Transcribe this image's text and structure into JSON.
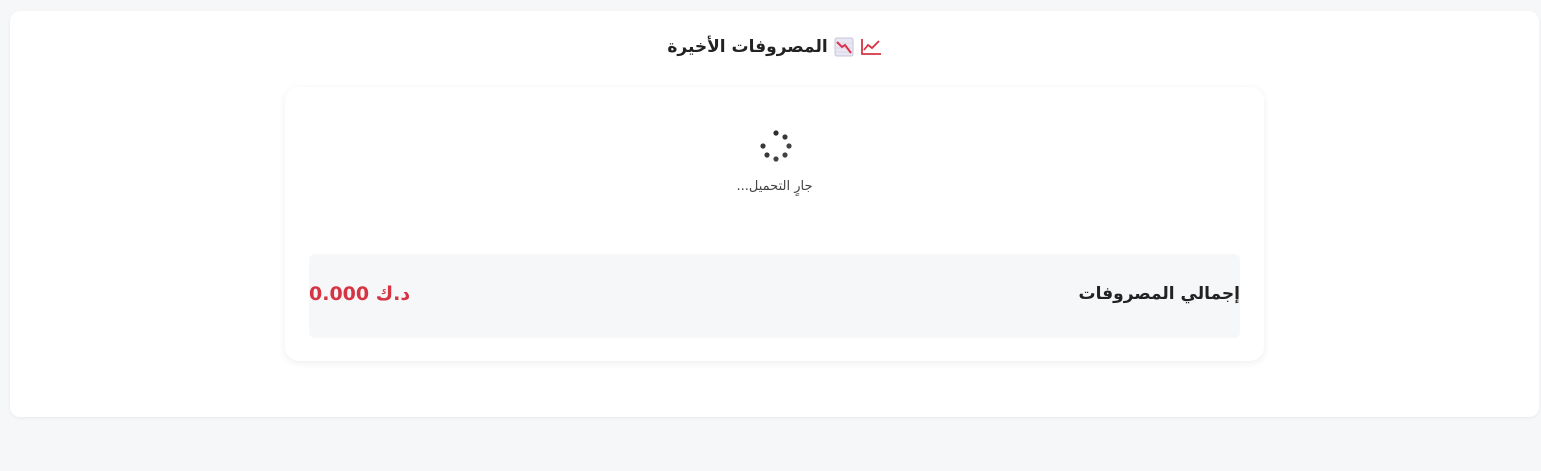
{
  "section": {
    "title": "المصروفات الأخيرة",
    "title_emoji": "chart-decreasing-emoji",
    "title_icon": "trend-line-icon",
    "accent_color": "#d63343"
  },
  "loading": {
    "text": "جارٍ التحميل...",
    "icon": "spinner-icon"
  },
  "summary": {
    "label": "إجمالي المصروفات",
    "value": "0.000 د.ك"
  }
}
